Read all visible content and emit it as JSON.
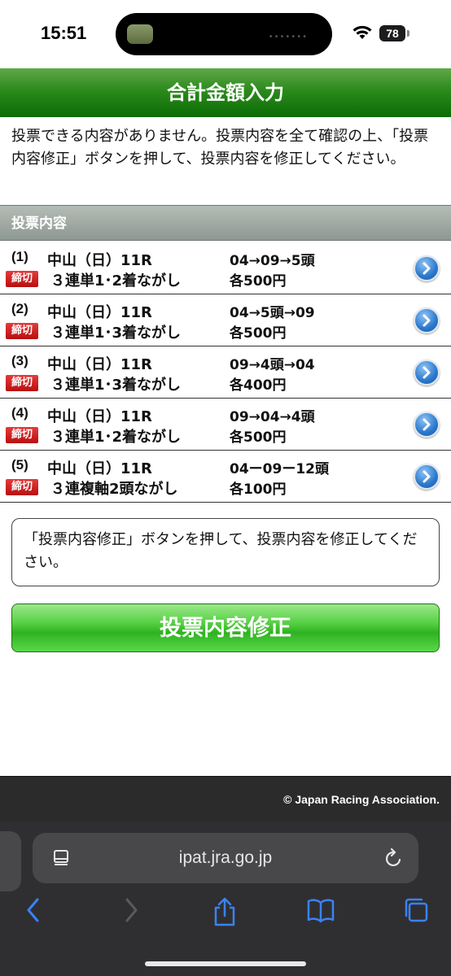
{
  "status": {
    "time": "15:51",
    "battery": "78"
  },
  "page": {
    "title": "合計金額入力",
    "notice": "投票できる内容がありません。投票内容を全て確認の上、「投票内容修正」ボタンを押して、投票内容を修正してください。",
    "section_label": "投票内容",
    "closed_badge": "締切",
    "bets": [
      {
        "num": "(1)",
        "venue": "中山（日）11R",
        "type": "３連単1･2着ながし",
        "combo": "04→09→5頭",
        "amount": "各500円"
      },
      {
        "num": "(2)",
        "venue": "中山（日）11R",
        "type": "３連単1･3着ながし",
        "combo": "04→5頭→09",
        "amount": "各500円"
      },
      {
        "num": "(3)",
        "venue": "中山（日）11R",
        "type": "３連単1･3着ながし",
        "combo": "09→4頭→04",
        "amount": "各400円"
      },
      {
        "num": "(4)",
        "venue": "中山（日）11R",
        "type": "３連単1･2着ながし",
        "combo": "09→04→4頭",
        "amount": "各500円"
      },
      {
        "num": "(5)",
        "venue": "中山（日）11R",
        "type": "３連複軸2頭ながし",
        "combo": "04ー09ー12頭",
        "amount": "各100円"
      }
    ],
    "message": "「投票内容修正」ボタンを押して、投票内容を修正してください。",
    "fix_button": "投票内容修正",
    "copyright": "© Japan Racing Association."
  },
  "browser": {
    "url": "ipat.jra.go.jp",
    "icons": [
      "reader-icon",
      "reload-icon",
      "back-icon",
      "forward-icon",
      "share-icon",
      "bookmarks-icon",
      "tabs-icon"
    ]
  },
  "colors": {
    "header_green": "#0b6c06",
    "button_green": "#2fb221",
    "closed_red": "#c41a1a",
    "ios_blue": "#3a82f7"
  }
}
